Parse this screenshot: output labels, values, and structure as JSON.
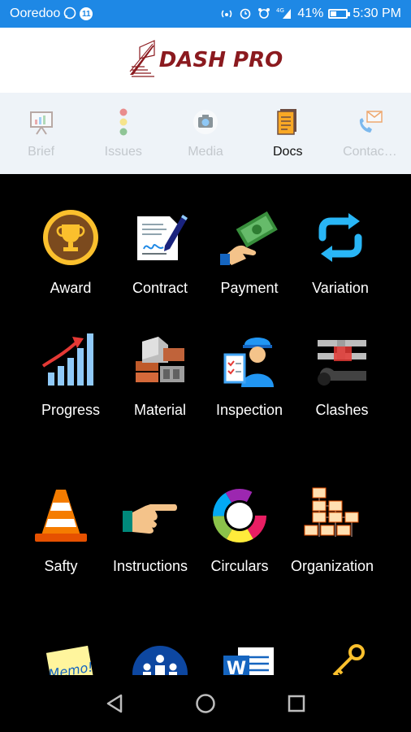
{
  "status_bar": {
    "carrier": "Ooredoo",
    "notification_count": "11",
    "signal_label": "4G",
    "battery_percent": "41%",
    "battery_level": 0.41,
    "time": "5:30 PM"
  },
  "header": {
    "logo_text": "DASH PRO"
  },
  "tabs": [
    {
      "label": "Brief",
      "icon": "presentation-board-icon",
      "active": false
    },
    {
      "label": "Issues",
      "icon": "traffic-light-icon",
      "active": false
    },
    {
      "label": "Media",
      "icon": "camera-icon",
      "active": false
    },
    {
      "label": "Docs",
      "icon": "documents-icon",
      "active": true
    },
    {
      "label": "Contac…",
      "icon": "contact-phone-mail-icon",
      "active": false
    }
  ],
  "tiles": [
    {
      "label": "Award",
      "icon": "trophy-icon"
    },
    {
      "label": "Contract",
      "icon": "contract-pen-icon"
    },
    {
      "label": "Payment",
      "icon": "money-hand-icon"
    },
    {
      "label": "Variation",
      "icon": "refresh-arrows-icon"
    },
    {
      "label": "Progress",
      "icon": "growth-chart-icon"
    },
    {
      "label": "Material",
      "icon": "bricks-icon"
    },
    {
      "label": "Inspection",
      "icon": "inspector-clipboard-icon"
    },
    {
      "label": "Clashes",
      "icon": "pipes-beams-icon"
    },
    {
      "label": "Safty",
      "icon": "traffic-cone-icon"
    },
    {
      "label": "Instructions",
      "icon": "pointing-hand-icon"
    },
    {
      "label": "Circulars",
      "icon": "cycle-arrows-icon"
    },
    {
      "label": "Organization",
      "icon": "org-chart-icon"
    },
    {
      "label": "",
      "icon": "memo-note-icon",
      "memo_text": "Memo!"
    },
    {
      "label": "",
      "icon": "meeting-icon"
    },
    {
      "label": "",
      "icon": "word-document-icon"
    },
    {
      "label": "",
      "icon": "key-handover-icon"
    }
  ],
  "colors": {
    "status_bar": "#1e88e5",
    "logo_red": "#8b1a1f",
    "tab_bar_bg": "#eef3f8",
    "tab_inactive": "#c3c8cd",
    "grid_bg": "#000000"
  }
}
